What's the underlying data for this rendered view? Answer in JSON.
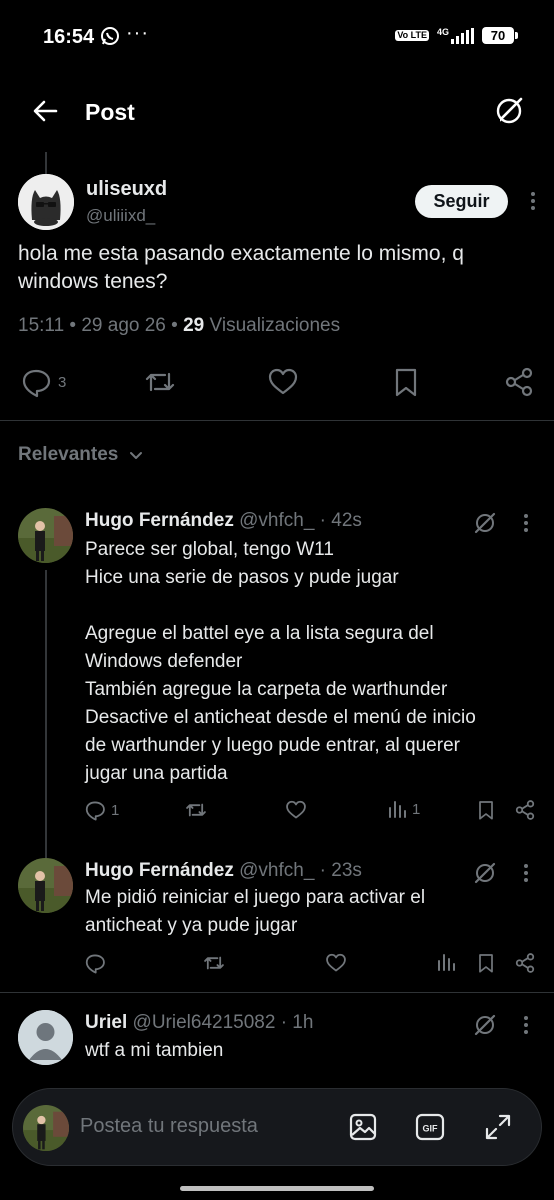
{
  "status_bar": {
    "time": "16:54",
    "dots": "···",
    "volte": "Vo LTE",
    "network": "4G",
    "battery": "70",
    "battery_level_percent": 70
  },
  "header": {
    "title": "Post"
  },
  "main_post": {
    "name": "uliseuxd",
    "handle": "@uliiixd_",
    "follow_label": "Seguir",
    "text": "hola me esta pasando exactamente lo mismo, q windows tenes?",
    "timestamp": "15:11 • 29 ago 26 • ",
    "views_count": "29",
    "views_label": " Visualizaciones",
    "reply_count": "3"
  },
  "sort": {
    "label": "Relevantes"
  },
  "replies": [
    {
      "name": "Hugo Fernández",
      "handle": "@vhfch_",
      "time": " · 42s",
      "lines": [
        "Parece ser global, tengo W11",
        "Hice una serie de pasos y pude jugar",
        "",
        "Agregue el battel eye a la lista segura del",
        "Windows defender",
        "También agregue la carpeta de warthunder",
        "Desactive el anticheat desde el menú de inicio",
        "de warthunder y luego pude entrar, al querer",
        "jugar una partida"
      ],
      "reply_count": "1",
      "views_count": "1"
    },
    {
      "name": "Hugo Fernández",
      "handle": "@vhfch_",
      "time": " · 23s",
      "lines": [
        "Me pidió reiniciar el juego para activar el",
        "anticheat y ya pude jugar"
      ],
      "reply_count": "",
      "views_count": ""
    },
    {
      "name": "Uriel",
      "handle": "@Uriel64215082",
      "time": " · 1h",
      "lines": [
        "wtf a mi tambien"
      ]
    }
  ],
  "composer": {
    "placeholder": "Postea tu respuesta",
    "gif_label": "GIF"
  },
  "colors": {
    "background": "#000000",
    "text_primary": "#e7e9ea",
    "text_secondary": "#71767b",
    "divider": "#2f3336",
    "follow_button_bg": "#eff3f4"
  },
  "icons": [
    "back-arrow-icon",
    "grok-icon",
    "reply-icon",
    "repost-icon",
    "like-icon",
    "bookmark-icon",
    "share-icon",
    "views-icon",
    "more-icon",
    "image-icon",
    "gif-icon",
    "expand-icon",
    "chevron-down-icon",
    "whatsapp-icon"
  ]
}
